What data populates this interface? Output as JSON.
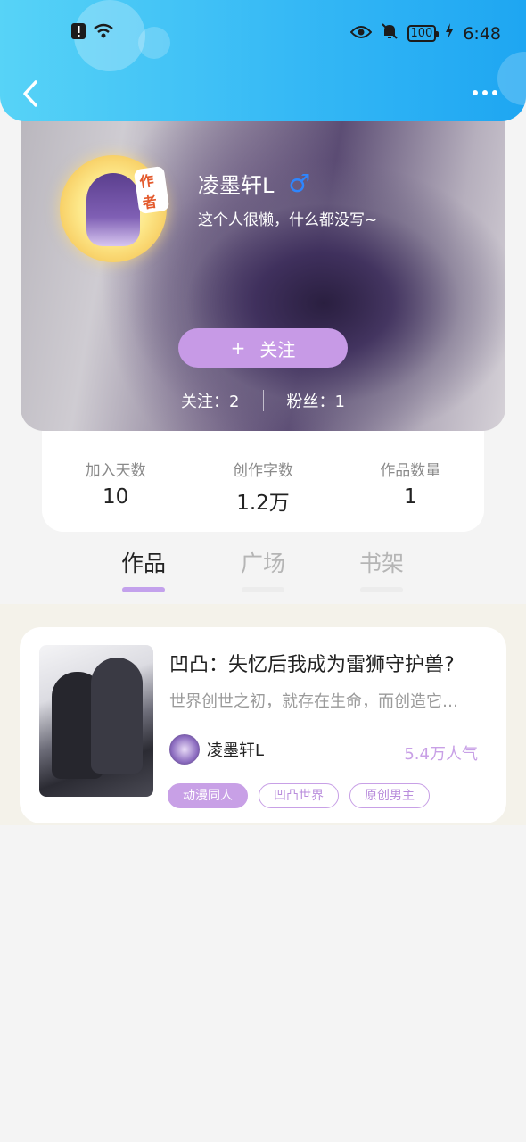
{
  "status_bar": {
    "time": "6:48",
    "battery": "100",
    "icons": [
      "alert-icon",
      "wifi-icon",
      "eye-icon",
      "bell-off-icon",
      "battery-icon",
      "charging-icon"
    ]
  },
  "header": {
    "back_icon": "chevron-left-icon",
    "more_icon": "more-dots-icon"
  },
  "profile": {
    "avatar_tag": "作者",
    "username": "凌墨轩L",
    "gender_symbol": "♂",
    "bio": "这个人很懒，什么都没写~",
    "follow_button": {
      "plus": "+",
      "label": "关注"
    },
    "following": "关注：2",
    "followers": "粉丝：1"
  },
  "stats": [
    {
      "label": "加入天数",
      "value": "10"
    },
    {
      "label": "创作字数",
      "value": "1.2万"
    },
    {
      "label": "作品数量",
      "value": "1"
    }
  ],
  "tabs": [
    {
      "label": "作品",
      "active": true
    },
    {
      "label": "广场",
      "active": false
    },
    {
      "label": "书架",
      "active": false
    }
  ],
  "work": {
    "title": "凹凸：失忆后我成为雷狮守护兽?",
    "description": "世界创世之初，就存在生命，而创造它…",
    "author": "凌墨轩L",
    "popularity": "5.4万人气",
    "tags": [
      "动漫同人",
      "凹凸世界",
      "原创男主"
    ]
  },
  "colors": {
    "header": "#36b9f5",
    "accent": "#c79ae6",
    "male": "#2e86ff",
    "tab_indicator": "#c3a1ec"
  }
}
